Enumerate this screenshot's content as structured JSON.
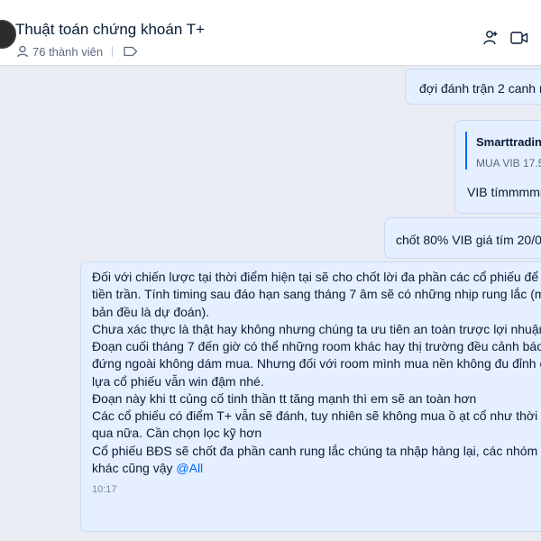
{
  "header": {
    "title": "Thuật toán chứng khoán T+",
    "members": "76 thành viên"
  },
  "messages": {
    "m1": "đợi đánh trận 2 canh r",
    "m2": {
      "quote_name": "Smarttrading",
      "quote_text": "MUA VIB 17.5",
      "text": "VIB tímmmmm"
    },
    "m3": "chốt 80% VIB giá tím 20/0",
    "m4": {
      "lines": [
        "Đối với chiến lược tại thời điểm hiện tại sẽ cho chốt lời đa phần các cổ phiếu để c",
        "tiền trần. Tính timing sau đáo hạn sang tháng 7 âm sẽ có những nhịp rung lắc (m",
        "bản đều là dự đoán).",
        "Chưa xác thực là thật hay không nhưng chúng ta ưu tiên an toàn trược lợi nhuận",
        "Đoạn cuối tháng 7 đến giờ có thể những room khác hay thị trường đều cảnh báo",
        "đứng ngoài không dám mua. Nhưng đối với room mình mua nền không đu đỉnh c",
        "lựa cổ phiếu vẫn win đậm nhé.",
        "Đoạn này khi tt củng cố tinh thần tt tăng mạnh thì em sẽ an toàn hơn",
        "Các cổ phiếu có điểm T+ vẫn sẽ đánh, tuy nhiên sẽ không mua ồ ạt cổ như thời g",
        "qua nữa. Cần chọn lọc kỹ hơn",
        "Cổ phiếu BĐS sẽ chốt đa phần canh rung lắc chúng ta nhập hàng lại, các nhóm n"
      ],
      "last_line": "khác cũng vậy",
      "mention": "@All",
      "time": "10:17"
    }
  },
  "icons": {
    "members": "person-icon",
    "tag": "tag-icon",
    "add_member": "add-member-icon",
    "video": "video-call-icon"
  },
  "colors": {
    "bubble": "#e5efff",
    "accent": "#0068ff",
    "background": "#e9ecf2"
  }
}
